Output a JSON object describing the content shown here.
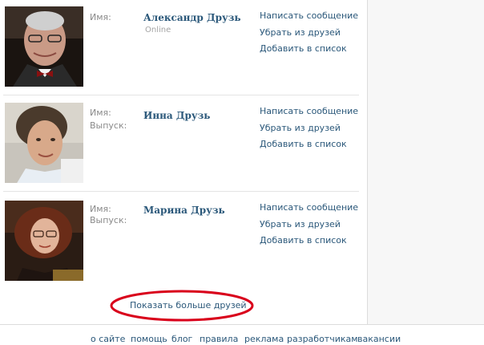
{
  "friends": [
    {
      "name_label": "Имя:",
      "name": "Александр Друзь",
      "status": "Online",
      "actions": [
        "Написать сообщение",
        "Убрать из друзей",
        "Добавить в список"
      ]
    },
    {
      "name_label": "Имя:",
      "graduation_label": "Выпуск:",
      "name": "Инна Друзь",
      "actions": [
        "Написать сообщение",
        "Убрать из друзей",
        "Добавить в список"
      ]
    },
    {
      "name_label": "Имя:",
      "graduation_label": "Выпуск:",
      "name": "Марина Друзь",
      "actions": [
        "Написать сообщение",
        "Убрать из друзей",
        "Добавить в список"
      ]
    }
  ],
  "show_more_label": "Показать больше друзей",
  "footer": {
    "links": [
      "о сайте",
      "помощь",
      "блог",
      "правила",
      "реклама",
      "разработчикам",
      "вакансии"
    ]
  },
  "colors": {
    "link": "#2b587a",
    "label": "#8a8a8a",
    "highlight_ellipse": "#d9001b"
  }
}
